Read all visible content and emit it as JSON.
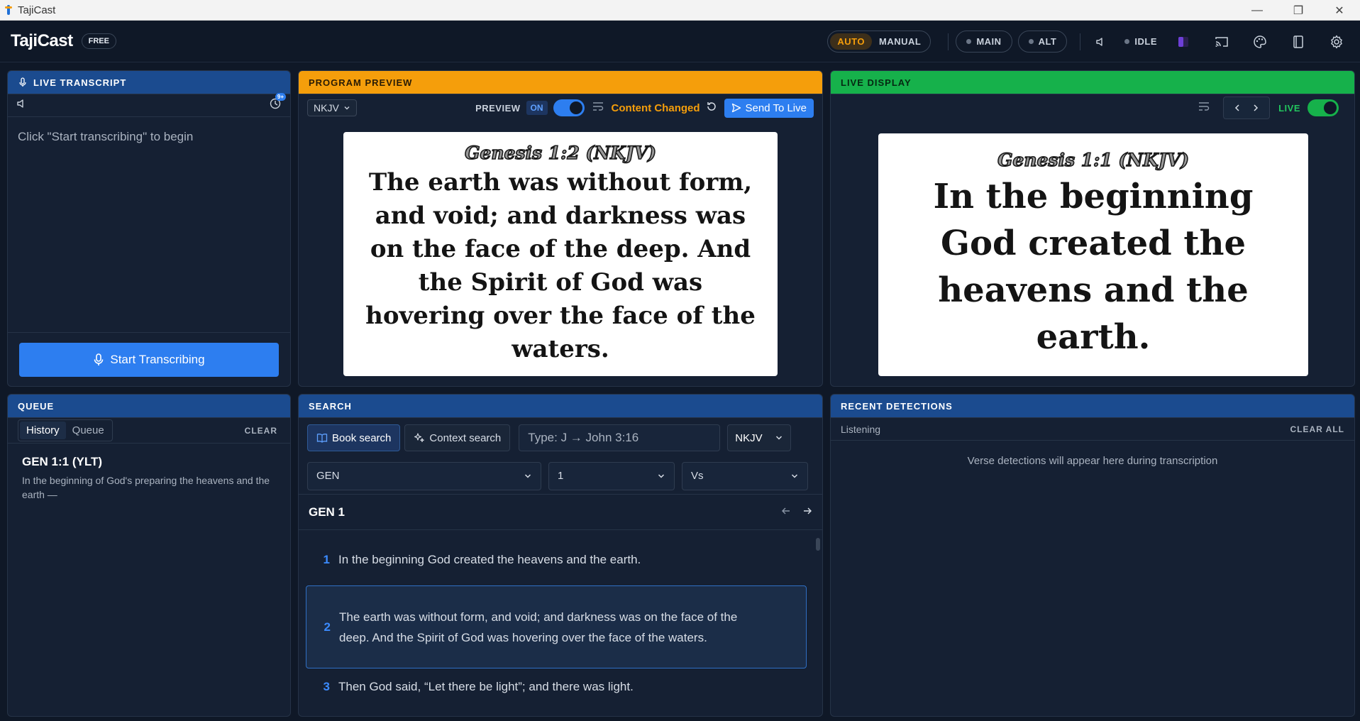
{
  "window": {
    "title": "TajiCast"
  },
  "header": {
    "brand": "TajiCast",
    "plan_badge": "FREE",
    "mode_auto": "AUTO",
    "mode_manual": "MANUAL",
    "output_main": "MAIN",
    "output_alt": "ALT",
    "status": "IDLE"
  },
  "live_transcript": {
    "title": "LIVE TRANSCRIPT",
    "history_badge": "9+",
    "hint": "Click \"Start transcribing\" to begin",
    "start_button": "Start Transcribing"
  },
  "program_preview": {
    "title": "PROGRAM PREVIEW",
    "version": "NKJV",
    "preview_label": "PREVIEW",
    "preview_state": "ON",
    "content_changed": "Content Changed",
    "send_button": "Send To Live",
    "slide_reference": "Genesis 1:2 (NKJV)",
    "slide_text": "The earth was without form, and void; and darkness was on the face of the deep. And the Spirit of God was hovering over the face of the waters."
  },
  "live_display": {
    "title": "LIVE DISPLAY",
    "live_label": "LIVE",
    "slide_reference": "Genesis 1:1 (NKJV)",
    "slide_text": "In the beginning God created the heavens and the earth."
  },
  "queue": {
    "title": "QUEUE",
    "tab_history": "History",
    "tab_queue": "Queue",
    "clear_label": "CLEAR",
    "items": [
      {
        "ref": "GEN 1:1 (YLT)",
        "text": "In the beginning of God's preparing the heavens and the earth —"
      }
    ]
  },
  "search": {
    "title": "SEARCH",
    "book_search": "Book search",
    "context_search": "Context search",
    "input_placeholder": "Type: J → John 3:16",
    "version": "NKJV",
    "book": "GEN",
    "chapter": "1",
    "verse": "Vs",
    "chapter_title": "GEN 1",
    "verses": [
      {
        "num": "1",
        "text": "In the beginning God created the heavens and the earth."
      },
      {
        "num": "2",
        "text": "The earth was without form, and void; and darkness was on the face of the deep. And the Spirit of God was hovering over the face of the waters."
      },
      {
        "num": "3",
        "text": "Then God said, “Let there be light”; and there was light."
      }
    ]
  },
  "recent_detections": {
    "title": "RECENT DETECTIONS",
    "status": "Listening",
    "clear_all": "CLEAR ALL",
    "empty": "Verse detections will appear here during transcription"
  },
  "colors": {
    "accent_blue": "#2d7ef0",
    "preview_orange": "#f59e0b",
    "live_green": "#16b14b",
    "background": "#0f1827"
  }
}
